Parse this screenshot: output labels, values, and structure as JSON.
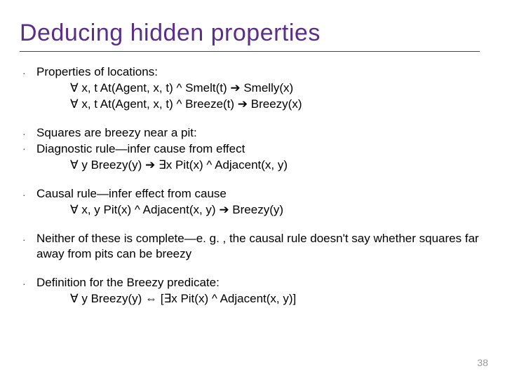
{
  "title": "Deducing hidden properties",
  "pagenum": "38",
  "b1": {
    "lead": "Properties of locations:",
    "l1": "∀ x, t At(Agent, x, t) ^ Smelt(t) ➔   Smelly(x)",
    "l2": "∀ x, t At(Agent, x, t) ^ Breeze(t) ➔   Breezy(x)"
  },
  "b2": {
    "l1": "Squares are breezy near a pit:",
    "l2": "Diagnostic rule—infer cause from effect",
    "l3": "∀ y Breezy(y) ➔   ∃x Pit(x) ^ Adjacent(x, y)"
  },
  "b3": {
    "lead": "Causal rule—infer effect from cause",
    "l1": "∀ x, y Pit(x) ^ Adjacent(x, y) ➔   Breezy(y)"
  },
  "b4": {
    "l1": "Neither of these is complete—e. g. , the causal rule doesn't say whether squares far away from pits can be breezy"
  },
  "b5": {
    "lead": "Definition for the Breezy predicate:",
    "l1": "∀ y Breezy(y) ⇔   [∃x Pit(x) ^ Adjacent(x, y)]"
  }
}
